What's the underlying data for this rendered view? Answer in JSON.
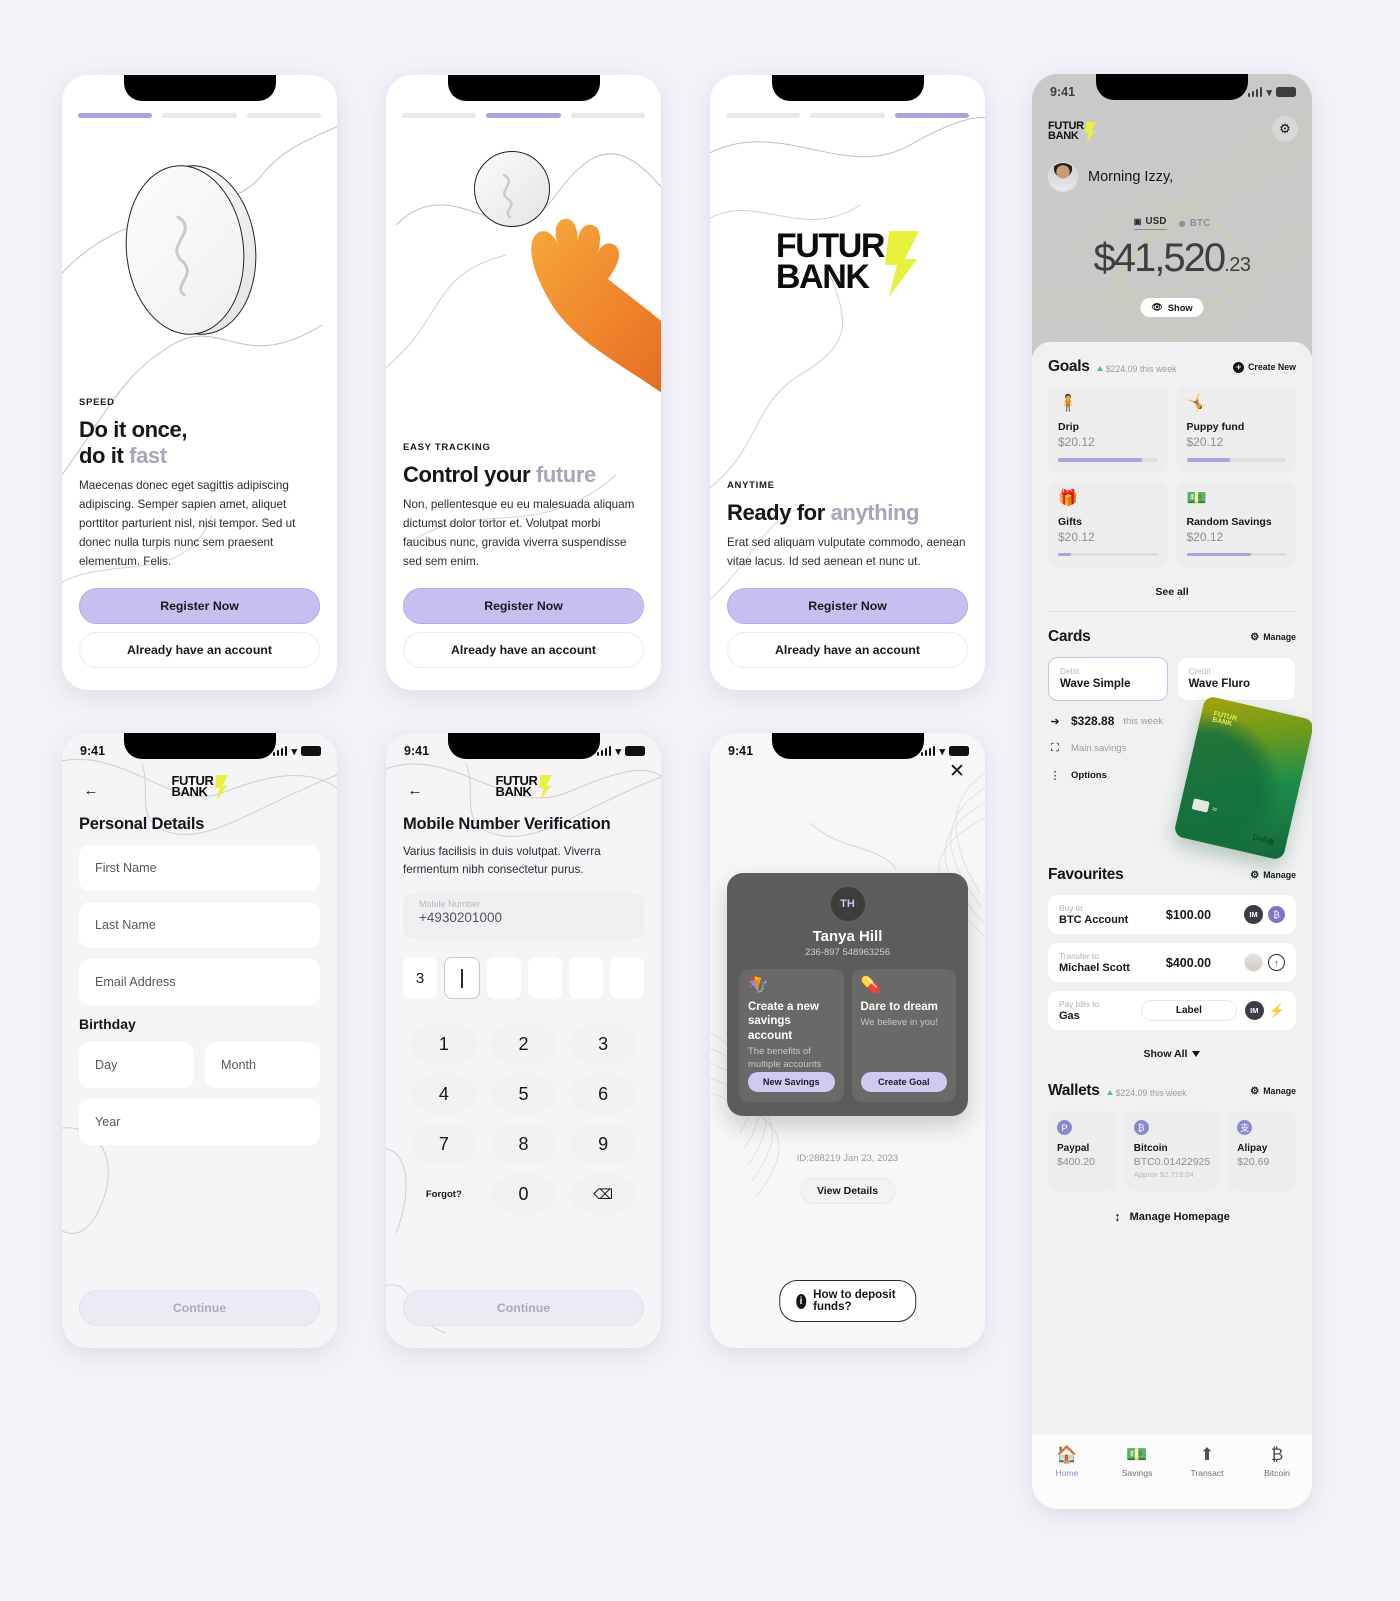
{
  "onboarding": [
    {
      "progress_active": 0,
      "eyebrow": "SPEED",
      "headline_1": "Do it once,",
      "headline_2": "do it ",
      "headline_accent": "fast",
      "body": "Maecenas donec eget sagittis adipiscing adipiscing. Semper sapien amet, aliquet porttitor parturient nisl, nisi tempor. Sed ut donec nulla turpis nunc sem praesent elementum. Felis.",
      "primary": "Register Now",
      "secondary": "Already have an account"
    },
    {
      "progress_active": 1,
      "eyebrow": "EASY TRACKING",
      "headline_1": "Control your ",
      "headline_2": "",
      "headline_accent": "future",
      "body": "Non, pellentesque eu eu malesuada aliquam dictumst dolor tortor et. Volutpat morbi faucibus nunc, gravida viverra suspendisse sed sem enim.",
      "primary": "Register Now",
      "secondary": "Already have an account"
    },
    {
      "progress_active": 2,
      "eyebrow": "ANYTIME",
      "headline_1": "Ready for ",
      "headline_2": "",
      "headline_accent": "anything",
      "body": "Erat sed aliquam vulputate commodo, aenean vitae lacus. Id sed aenean et nunc ut.",
      "primary": "Register Now",
      "secondary": "Already have an account",
      "logo_line1": "FUTUR",
      "logo_line2": "BANK"
    }
  ],
  "status_bar": {
    "time": "9:41"
  },
  "brand": {
    "line1": "FUTUR",
    "line2": "BANK",
    "bolt_color": "#e8f13c"
  },
  "personal_details": {
    "title": "Personal Details",
    "fields": [
      {
        "placeholder": "First Name"
      },
      {
        "placeholder": "Last Name"
      },
      {
        "placeholder": "Email Address"
      }
    ],
    "birthday_label": "Birthday",
    "day_placeholder": "Day",
    "month_placeholder": "Month",
    "year_placeholder": "Year",
    "continue_label": "Continue"
  },
  "mobile_verification": {
    "title": "Mobile Number Verification",
    "subtitle": "Varius facilisis in duis volutpat. Viverra fermentum nibh consectetur purus.",
    "field_label": "Mobile Number",
    "field_value": "+4930201000",
    "otp": [
      "3",
      "",
      "",
      "",
      "",
      ""
    ],
    "keys": [
      "1",
      "2",
      "3",
      "4",
      "5",
      "6",
      "7",
      "8",
      "9",
      "Forgot?",
      "0",
      "⌫"
    ],
    "continue_label": "Continue"
  },
  "transfer_card": {
    "avatar_initials": "TH",
    "name": "Tanya Hill",
    "account_number": "236-897 548963256",
    "promos": [
      {
        "emoji": "🪁",
        "title": "Create a new savings account",
        "desc": "The benefits of multiple accounts",
        "button": "New Savings"
      },
      {
        "emoji": "💊",
        "title": "Dare to dream",
        "desc": "We believe in you!",
        "button": "Create Goal"
      }
    ],
    "id_line": "ID:288219 Jan 23, 2023",
    "view_details": "View Details",
    "deposit_help": "How to deposit funds?"
  },
  "dashboard": {
    "greeting": "Morning Izzy,",
    "currencies": [
      {
        "label": "USD",
        "active": true
      },
      {
        "label": "BTC",
        "active": false
      }
    ],
    "balance_main": "$41,520",
    "balance_cents": ".23",
    "show_label": "Show",
    "goals": {
      "title": "Goals",
      "meta": "$224.09 this week",
      "action": "Create New",
      "items": [
        {
          "emoji": "🧍",
          "name": "Drip",
          "amount": "$20.12",
          "progress": 84
        },
        {
          "emoji": "🤸",
          "name": "Puppy fund",
          "amount": "$20.12",
          "progress": 44
        },
        {
          "emoji": "🎁",
          "name": "Gifts",
          "amount": "$20.12",
          "progress": 13
        },
        {
          "emoji": "💵",
          "name": "Random Savings",
          "amount": "$20.12",
          "progress": 65
        }
      ],
      "see_all": "See all"
    },
    "cards": {
      "title": "Cards",
      "action": "Manage",
      "tabs": [
        {
          "type": "Debit",
          "name": "Wave Simple",
          "active": true
        },
        {
          "type": "Credit",
          "name": "Wave Fluro",
          "active": false
        }
      ],
      "spend_amount": "$328.88",
      "spend_period": "this week",
      "account": "Main savings",
      "options": "Options"
    },
    "favourites": {
      "title": "Favourites",
      "action": "Manage",
      "rows": [
        {
          "label": "Buy to",
          "name": "BTC Account",
          "amount": "$100.00",
          "avatar": "IM",
          "chip": "btc"
        },
        {
          "label": "Transfer to",
          "name": "Michael Scott",
          "amount": "$400.00",
          "avatar": "photo",
          "chip": "up"
        },
        {
          "label": "Pay bills to",
          "name": "Gas",
          "pill": "Label",
          "avatar": "IM",
          "chip": "bolt"
        }
      ],
      "show_all": "Show All"
    },
    "wallets": {
      "title": "Wallets",
      "meta": "$224.09 this week",
      "action": "Manage",
      "items": [
        {
          "icon": "P",
          "name": "Paypal",
          "amount": "$400.20",
          "extra": ""
        },
        {
          "icon": "₿",
          "name": "Bitcoin",
          "amount": "BTC0.01422925",
          "extra": "Approx $2,719.04"
        },
        {
          "icon": "支",
          "name": "Alipay",
          "amount": "$20.69",
          "extra": ""
        }
      ]
    },
    "manage_homepage": "Manage Homepage",
    "tabbar": [
      {
        "icon": "🏠",
        "label": "Home",
        "active": true
      },
      {
        "icon": "💵",
        "label": "Savings",
        "active": false
      },
      {
        "icon": "⬆",
        "label": "Transact",
        "active": false
      },
      {
        "icon": "₿",
        "label": "Bitcoin",
        "active": false
      }
    ]
  }
}
